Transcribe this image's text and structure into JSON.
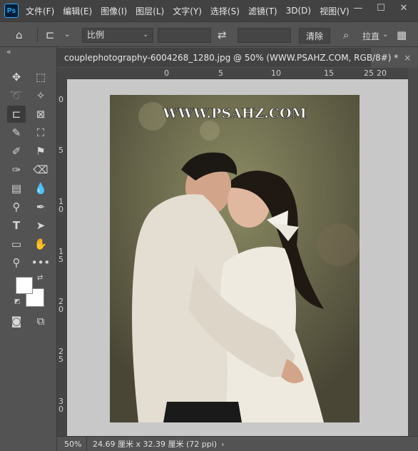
{
  "app": {
    "logo_text": "Ps"
  },
  "menubar": {
    "items": [
      "文件(F)",
      "编辑(E)",
      "图像(I)",
      "图层(L)",
      "文字(Y)",
      "选择(S)",
      "滤镜(T)",
      "3D(D)",
      "视图(V)"
    ],
    "window_controls": {
      "minimize": "—",
      "maximize": "☐",
      "close": "✕"
    }
  },
  "options_bar": {
    "home_icon": "home-icon",
    "crop_icon": "crop-icon",
    "ratio_label": "比例",
    "swap_icon": "swap-icon",
    "clear_label": "清除",
    "search_icon": "search-icon",
    "straighten_label": "拉直"
  },
  "document": {
    "tab_title": "couplephotography-6004268_1280.jpg @ 50% (WWW.PSAHZ.COM, RGB/8#) *",
    "tab_close": "×",
    "watermark": "WWW.PSAHZ.COM"
  },
  "ruler_h_labels": [
    "0",
    "5",
    "10",
    "15",
    "20",
    "25"
  ],
  "ruler_v_labels": [
    "0",
    "5",
    "10",
    "15",
    "20",
    "25",
    "30"
  ],
  "status": {
    "zoom": "50%",
    "doc_info": "24.69 厘米 x 32.39 厘米 (72 ppi)",
    "more_arrow": "›"
  },
  "colors": {
    "foreground": "#ffffff",
    "background": "#ffffff",
    "canvas_bg": "#c8c8c8",
    "ui_dark": "#424242",
    "ui_mid": "#535353"
  }
}
